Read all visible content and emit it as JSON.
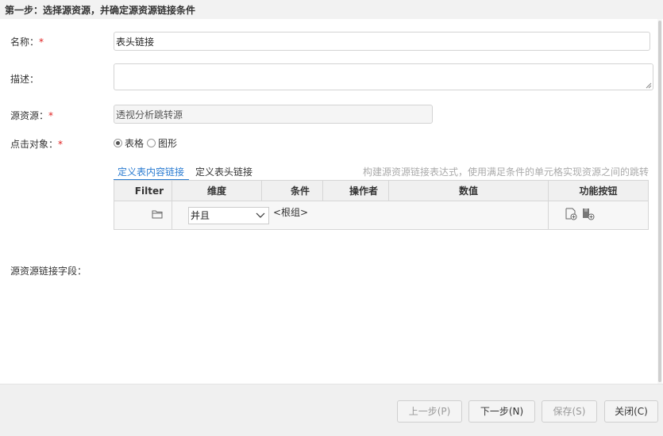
{
  "header": {
    "title": "第一步：选择源资源，并确定源资源链接条件"
  },
  "form": {
    "name_label": "名称：",
    "name_value": "表头链接",
    "desc_label": "描述：",
    "desc_value": "",
    "source_label": "源资源：",
    "source_value": "透视分析跳转源",
    "click_label": "点击对象：",
    "required_mark": "*",
    "click_options": [
      {
        "label": "表格",
        "checked": true
      },
      {
        "label": "图形",
        "checked": false
      }
    ],
    "link_field_label": "源资源链接字段："
  },
  "tabs": [
    {
      "label": "定义表内容链接",
      "active": true
    },
    {
      "label": "定义表头链接",
      "active": false
    }
  ],
  "hint": "构建源资源链接表达式，使用满足条件的单元格实现资源之间的跳转",
  "grid": {
    "columns": [
      "Filter",
      "维度",
      "条件",
      "操作者",
      "数值",
      "功能按钮"
    ],
    "row": {
      "logic_value": "并且",
      "group_label": "<根组>"
    }
  },
  "footer": {
    "prev": "上一步(P)",
    "next": "下一步(N)",
    "save": "保存(S)",
    "close": "关闭(C)"
  }
}
